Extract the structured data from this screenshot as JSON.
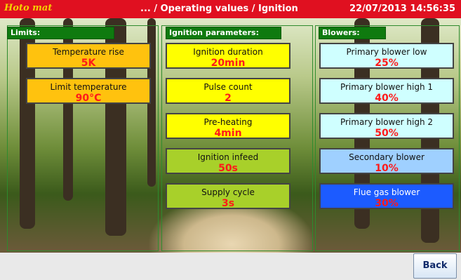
{
  "header": {
    "logo_text": "Hoto mat",
    "breadcrumb": "... / Operating values / Ignition",
    "datetime": "22/07/2013 14:56:35"
  },
  "columns": {
    "limits": {
      "title": "Limits:",
      "items": [
        {
          "label": "Temperature rise",
          "value": "5K",
          "color": "#ffc20e"
        },
        {
          "label": "Limit temperature",
          "value": "90°C",
          "color": "#ffc20e"
        }
      ]
    },
    "ignition": {
      "title": "Ignition parameters:",
      "items": [
        {
          "label": "Ignition duration",
          "value": "20min",
          "color": "#ffff00"
        },
        {
          "label": "Pulse count",
          "value": "2",
          "color": "#ffff00"
        },
        {
          "label": "Pre-heating",
          "value": "4min",
          "color": "#ffff00"
        },
        {
          "label": "Ignition infeed",
          "value": "50s",
          "color": "#a8d02a"
        },
        {
          "label": "Supply cycle",
          "value": "3s",
          "color": "#a8d02a"
        }
      ]
    },
    "blowers": {
      "title": "Blowers:",
      "items": [
        {
          "label": "Primary blower low",
          "value": "25%",
          "color": "#cfffff"
        },
        {
          "label": "Primary blower high 1",
          "value": "40%",
          "color": "#cfffff"
        },
        {
          "label": "Primary blower high 2",
          "value": "50%",
          "color": "#cfffff"
        },
        {
          "label": "Secondary blower",
          "value": "10%",
          "color": "#9fd0ff"
        },
        {
          "label": "Flue gas blower",
          "value": "30%",
          "color": "#1c5bff"
        }
      ]
    }
  },
  "footer": {
    "back_label": "Back"
  }
}
